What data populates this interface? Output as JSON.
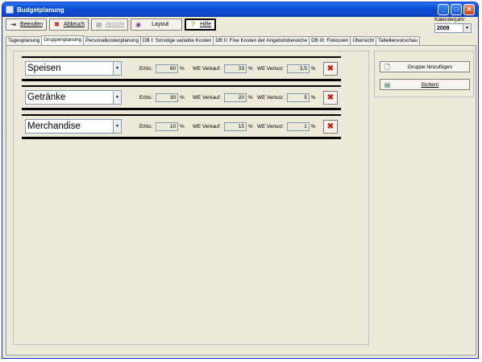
{
  "window": {
    "title": "Budgetplanung"
  },
  "toolbar": {
    "buttons": [
      {
        "label": "Beenden",
        "underline_first": true,
        "icon": "exit-icon",
        "disabled": false,
        "pressed": false
      },
      {
        "label": "Abbruch",
        "underline_first": true,
        "icon": "cancel-icon",
        "disabled": false,
        "pressed": false
      },
      {
        "label": "Ansicht",
        "underline_first": true,
        "icon": "view-icon",
        "disabled": true,
        "pressed": false
      },
      {
        "label": "Layout",
        "underline_first": false,
        "icon": "layout-icon",
        "disabled": false,
        "pressed": false
      },
      {
        "label": "Hilfe",
        "underline_first": true,
        "icon": "help-icon",
        "disabled": false,
        "pressed": true
      }
    ]
  },
  "year": {
    "label": "Kalenderjahr:",
    "value": "2009"
  },
  "tabs": [
    {
      "label": "Tagesplanung",
      "active": false
    },
    {
      "label": "Gruppenplanung",
      "active": true
    },
    {
      "label": "Personalkostenplanung",
      "active": false
    },
    {
      "label": "DB I: Sonstige variable Kosten",
      "active": false
    },
    {
      "label": "DB II: Fixe Kosten der Angebotsbereiche",
      "active": false
    },
    {
      "label": "DB III: Fixkosten",
      "active": false
    },
    {
      "label": "Übersicht",
      "active": false
    },
    {
      "label": "Tabellenvorschau",
      "active": false
    }
  ],
  "labels": {
    "erloes": "Erlös:",
    "we_verkauf": "WE Verkauf:",
    "we_verlust": "WE Verlust:",
    "pct": "%"
  },
  "groups": [
    {
      "name": "Speisen",
      "erloes": "60",
      "we_verkauf": "33",
      "we_verlust": "3,5"
    },
    {
      "name": "Getränke",
      "erloes": "30",
      "we_verkauf": "20",
      "we_verlust": "5"
    },
    {
      "name": "Merchandise",
      "erloes": "10",
      "we_verkauf": "15",
      "we_verlust": "1"
    }
  ],
  "actions": {
    "add_group": "Gruppe hinzufügen",
    "save": "Sichern"
  },
  "colors": {
    "titlebar": "#0a50d8",
    "window_bg": "#ece9d8",
    "delete_accent": "#d02010"
  }
}
